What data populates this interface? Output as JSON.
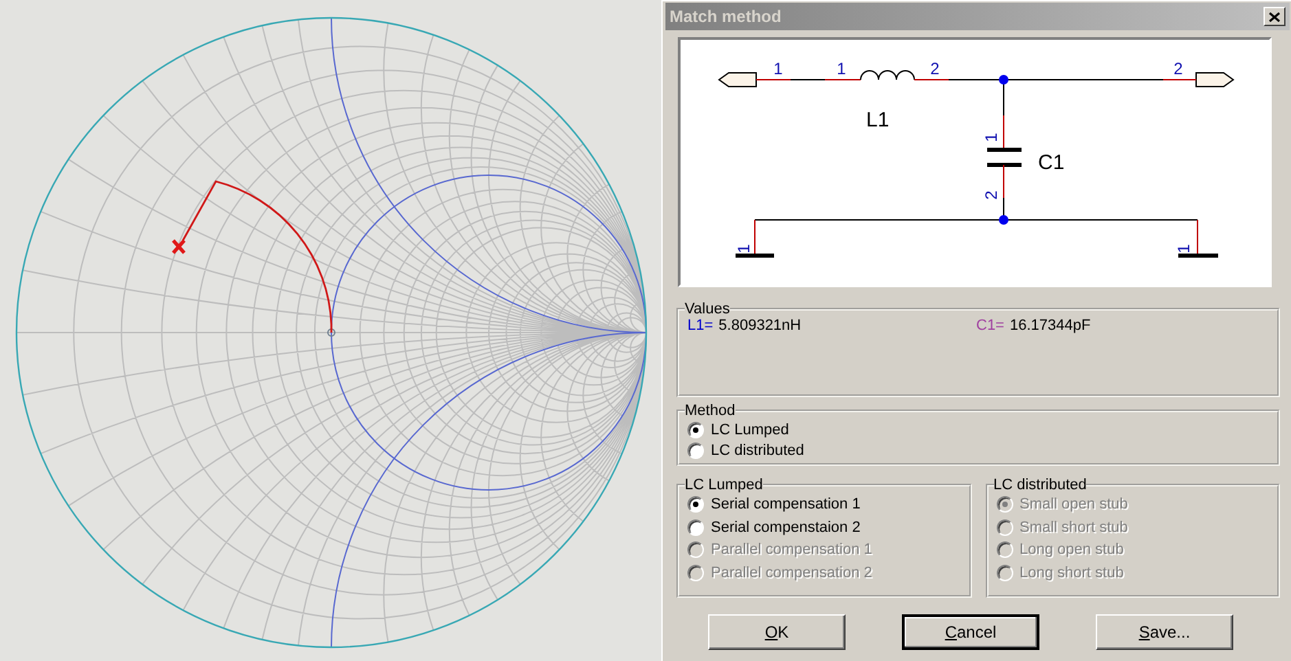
{
  "window": {
    "title": "Match method"
  },
  "schematic": {
    "components": [
      {
        "label": "L1"
      },
      {
        "label": "C1"
      }
    ],
    "pin_numbers": [
      "1",
      "1",
      "2",
      "2",
      "1",
      "2",
      "1",
      "1"
    ]
  },
  "values": {
    "title": "Values",
    "items": [
      {
        "name": "L1=",
        "value": "5.809321nH",
        "color": "#0000cc"
      },
      {
        "name": "C1=",
        "value": "16.17344pF",
        "color": "#a040a0"
      }
    ]
  },
  "method": {
    "title": "Method",
    "options": [
      {
        "label": "LC Lumped",
        "selected": true,
        "disabled": false
      },
      {
        "label": "LC distributed",
        "selected": false,
        "disabled": false
      }
    ]
  },
  "lc_lumped": {
    "title": "LC Lumped",
    "options": [
      {
        "label": "Serial compensation 1",
        "selected": true,
        "disabled": false
      },
      {
        "label": "Serial compenstaion 2",
        "selected": false,
        "disabled": false
      },
      {
        "label": "Parallel compensation 1",
        "selected": false,
        "disabled": true
      },
      {
        "label": "Parallel compensation 2",
        "selected": false,
        "disabled": true
      }
    ]
  },
  "lc_distributed": {
    "title": "LC distributed",
    "options": [
      {
        "label": "Small open stub",
        "selected": true,
        "disabled": true
      },
      {
        "label": "Small short stub",
        "selected": false,
        "disabled": true
      },
      {
        "label": "Long open stub",
        "selected": false,
        "disabled": true
      },
      {
        "label": "Long short stub",
        "selected": false,
        "disabled": true
      }
    ]
  },
  "buttons": [
    {
      "label": "OK",
      "default": false
    },
    {
      "label": "Cancel",
      "default": true
    },
    {
      "label": "Save...",
      "default": false
    }
  ]
}
